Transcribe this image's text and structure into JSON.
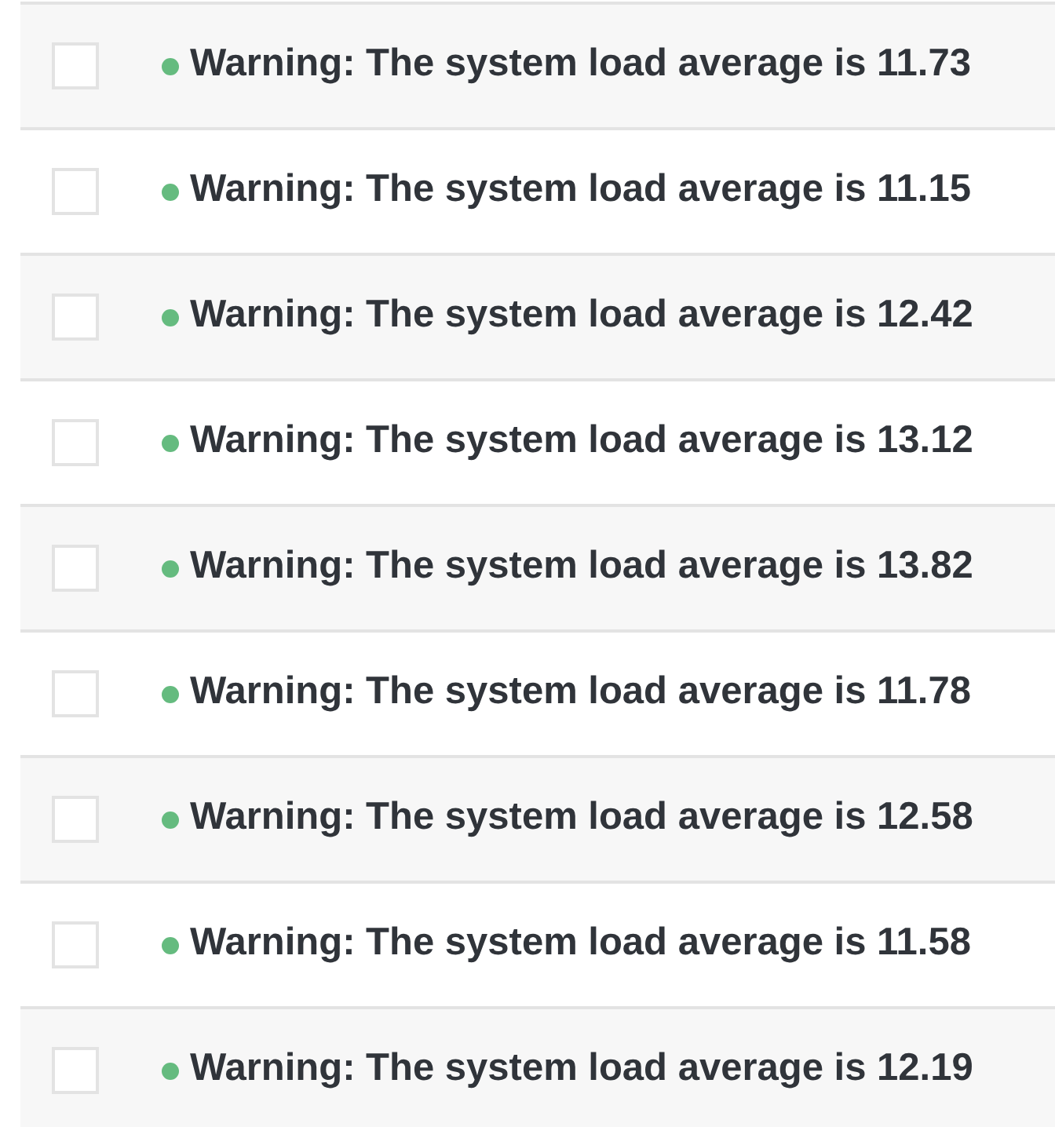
{
  "rows": [
    {
      "checked": false,
      "color": "#65bb7f",
      "message": "Warning: The system load average is 11.73"
    },
    {
      "checked": false,
      "color": "#65bb7f",
      "message": "Warning: The system load average is 11.15"
    },
    {
      "checked": false,
      "color": "#65bb7f",
      "message": "Warning: The system load average is 12.42"
    },
    {
      "checked": false,
      "color": "#65bb7f",
      "message": "Warning: The system load average is 13.12"
    },
    {
      "checked": false,
      "color": "#65bb7f",
      "message": "Warning: The system load average is 13.82"
    },
    {
      "checked": false,
      "color": "#65bb7f",
      "message": "Warning: The system load average is 11.78"
    },
    {
      "checked": false,
      "color": "#65bb7f",
      "message": "Warning: The system load average is 12.58"
    },
    {
      "checked": false,
      "color": "#65bb7f",
      "message": "Warning: The system load average is 11.58"
    },
    {
      "checked": false,
      "color": "#65bb7f",
      "message": "Warning: The system load average is 12.19"
    }
  ]
}
